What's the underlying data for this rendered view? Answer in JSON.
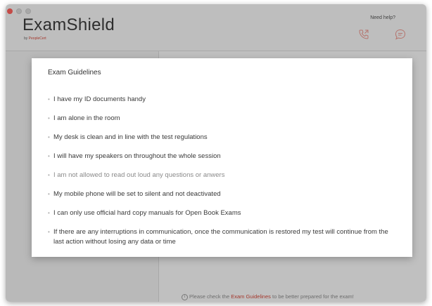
{
  "app": {
    "logo": "ExamShield",
    "logo_by": "by ",
    "logo_brand": "PeopleCert",
    "need_help": "Need help?"
  },
  "modal": {
    "title": "Exam Guidelines",
    "items": [
      "I have my ID documents handy",
      "I am alone in the room",
      "My desk is clean and in line with the test regulations",
      "I will have my speakers on throughout the whole session",
      "I am not allowed to read out loud any questions or anwers",
      "My mobile phone will be set to silent and not deactivated",
      "I can only use official hard copy manuals for Open Book Exams",
      "If there are any interruptions in communication, once the communication is restored my test will continue from the last action without losing any data or time"
    ]
  },
  "footer": {
    "before": "Please check the ",
    "link": "Exam Guidelines",
    "after": " to be better prepared for the exam!"
  },
  "colors": {
    "accent": "#d24a3c",
    "window_bg": "#f4f4f4"
  },
  "icons": [
    "phone-icon",
    "chat-icon",
    "info-icon"
  ]
}
